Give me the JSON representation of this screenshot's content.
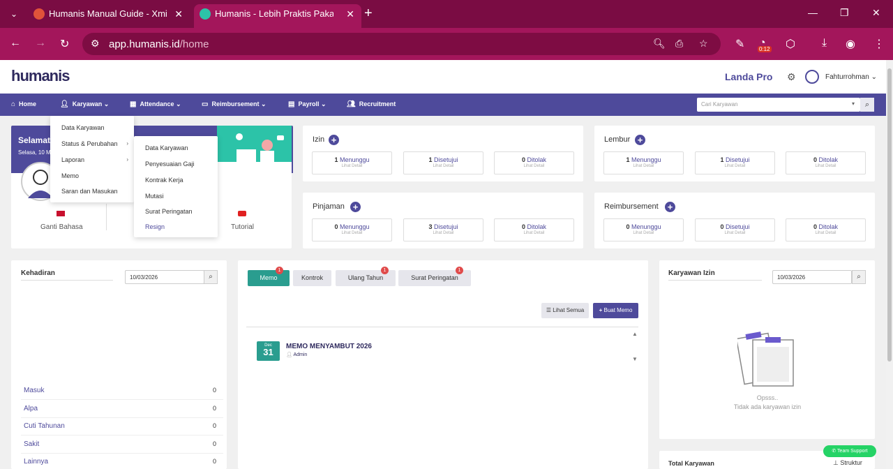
{
  "browser": {
    "tabs": [
      {
        "title": "Humanis Manual Guide - Xmind",
        "active": false
      },
      {
        "title": "Humanis - Lebih Praktis Pakai Humanis",
        "active": true
      }
    ],
    "url_host": "app.humanis.id",
    "url_path": "/home",
    "timer_badge": "0:12"
  },
  "header": {
    "logo": "humanis",
    "company": "Landa Pro",
    "username": "Fahturrohman"
  },
  "nav": {
    "items": [
      "Home",
      "Karyawan",
      "Attendance",
      "Reimbursement",
      "Payroll",
      "Recruitment"
    ],
    "search_placeholder": "Cari Karyawan"
  },
  "karyawan_menu": {
    "items": [
      "Data Karyawan",
      "Status & Perubahan",
      "Laporan",
      "Memo",
      "Saran dan Masukan"
    ]
  },
  "status_submenu": {
    "items": [
      "Data Karyawan",
      "Penyesuaian Gaji",
      "Kontrak Kerja",
      "Mutasi",
      "Surat Peringatan",
      "Resign"
    ]
  },
  "welcome": {
    "title": "Selamat",
    "date": "Selasa, 10 M",
    "quick_actions": [
      "Ganti Bahasa",
      "Tutorial"
    ]
  },
  "requests": {
    "izin": {
      "title": "Izin",
      "stats": [
        {
          "count": "1",
          "label": "Menunggu"
        },
        {
          "count": "1",
          "label": "Disetujui"
        },
        {
          "count": "0",
          "label": "Ditolak"
        }
      ]
    },
    "lembur": {
      "title": "Lembur",
      "stats": [
        {
          "count": "1",
          "label": "Menunggu"
        },
        {
          "count": "1",
          "label": "Disetujui"
        },
        {
          "count": "0",
          "label": "Ditolak"
        }
      ]
    },
    "pinjaman": {
      "title": "Pinjaman",
      "stats": [
        {
          "count": "0",
          "label": "Menunggu"
        },
        {
          "count": "3",
          "label": "Disetujui"
        },
        {
          "count": "0",
          "label": "Ditolak"
        }
      ]
    },
    "reimbursement": {
      "title": "Reimbursement",
      "stats": [
        {
          "count": "0",
          "label": "Menunggu"
        },
        {
          "count": "0",
          "label": "Disetujui"
        },
        {
          "count": "0",
          "label": "Ditolak"
        }
      ]
    },
    "detail_label": "Lihat Detail"
  },
  "kehadiran": {
    "title": "Kehadiran",
    "date": "10/03/2026",
    "rows": [
      {
        "label": "Masuk",
        "value": "0"
      },
      {
        "label": "Alpa",
        "value": "0"
      },
      {
        "label": "Cuti Tahunan",
        "value": "0"
      },
      {
        "label": "Sakit",
        "value": "0"
      },
      {
        "label": "Lainnya",
        "value": "0"
      }
    ]
  },
  "memo_panel": {
    "tabs": [
      {
        "label": "Memo",
        "badge": "1"
      },
      {
        "label": "Kontrok",
        "badge": ""
      },
      {
        "label": "Ulang Tahun",
        "badge": "1"
      },
      {
        "label": "Surat Peringatan",
        "badge": "1"
      }
    ],
    "lihat_semua": "Lihat Semua",
    "buat_memo": "Buat Memo",
    "memo": {
      "month": "Dec",
      "day": "31",
      "title": "MEMO MENYAMBUT 2026",
      "author": "Admin"
    }
  },
  "karyawan_izin": {
    "title": "Karyawan Izin",
    "date": "10/03/2026",
    "empty_title": "Opsss..",
    "empty_text": "Tidak ada karyawan izin"
  },
  "total_karyawan": {
    "title": "Total Karyawan",
    "struktur": "Struktur"
  },
  "team_support": "Team Support"
}
